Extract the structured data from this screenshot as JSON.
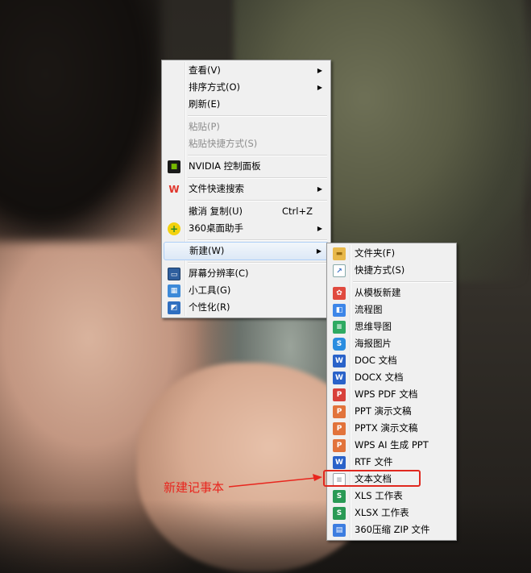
{
  "main_menu": {
    "items": [
      {
        "label": "查看(V)",
        "submenu": true,
        "disabled": false
      },
      {
        "label": "排序方式(O)",
        "submenu": true,
        "disabled": false
      },
      {
        "label": "刷新(E)",
        "submenu": false,
        "disabled": false
      },
      {
        "label": "粘贴(P)",
        "submenu": false,
        "disabled": true
      },
      {
        "label": "粘贴快捷方式(S)",
        "submenu": false,
        "disabled": true
      },
      {
        "label": "NVIDIA 控制面板",
        "icon": "nvidia-icon"
      },
      {
        "label": "文件快速搜索",
        "icon": "wps-icon",
        "submenu": true
      },
      {
        "label": "撤消 复制(U)",
        "shortcut": "Ctrl+Z"
      },
      {
        "label": "360桌面助手",
        "icon": "360-icon",
        "submenu": true
      },
      {
        "label": "新建(W)",
        "submenu": true,
        "active": true
      },
      {
        "label": "屏幕分辨率(C)",
        "icon": "monitor-icon"
      },
      {
        "label": "小工具(G)",
        "icon": "gadgets-icon"
      },
      {
        "label": "个性化(R)",
        "icon": "personalize-icon"
      }
    ]
  },
  "sub_menu": {
    "items": [
      {
        "label": "文件夹(F)",
        "icon": "folder-icon",
        "color": "#e8b84a"
      },
      {
        "label": "快捷方式(S)",
        "icon": "shortcut-icon",
        "color": "#3a6fc4"
      },
      {
        "label": "从模板新建",
        "icon": "template-icon",
        "color": "#e04a3f"
      },
      {
        "label": "流程图",
        "icon": "flowchart-icon",
        "color": "#3d86e8"
      },
      {
        "label": "思维导图",
        "icon": "mindmap-icon",
        "color": "#2eaa62"
      },
      {
        "label": "海报图片",
        "icon": "poster-icon",
        "color": "#2a8de0"
      },
      {
        "label": "DOC 文档",
        "icon": "doc-icon",
        "color": "#2a62c9"
      },
      {
        "label": "DOCX 文档",
        "icon": "docx-icon",
        "color": "#2a62c9"
      },
      {
        "label": "WPS PDF 文档",
        "icon": "pdf-icon",
        "color": "#d8403a"
      },
      {
        "label": "PPT 演示文稿",
        "icon": "ppt-icon",
        "color": "#e2733b"
      },
      {
        "label": "PPTX 演示文稿",
        "icon": "pptx-icon",
        "color": "#e2733b"
      },
      {
        "label": "WPS AI 生成 PPT",
        "icon": "ai-ppt-icon",
        "color": "#e2733b"
      },
      {
        "label": "RTF 文件",
        "icon": "rtf-icon",
        "color": "#2a62c9"
      },
      {
        "label": "文本文档",
        "icon": "text-document-icon",
        "color": "#ffffff"
      },
      {
        "label": "XLS 工作表",
        "icon": "xls-icon",
        "color": "#2a9a55"
      },
      {
        "label": "XLSX 工作表",
        "icon": "xlsx-icon",
        "color": "#2a9a55"
      },
      {
        "label": "360压缩 ZIP 文件",
        "icon": "zip-icon",
        "color": "#3d7de0"
      }
    ]
  },
  "annotation": {
    "label": "新建记事本",
    "color": "#e8261e"
  }
}
